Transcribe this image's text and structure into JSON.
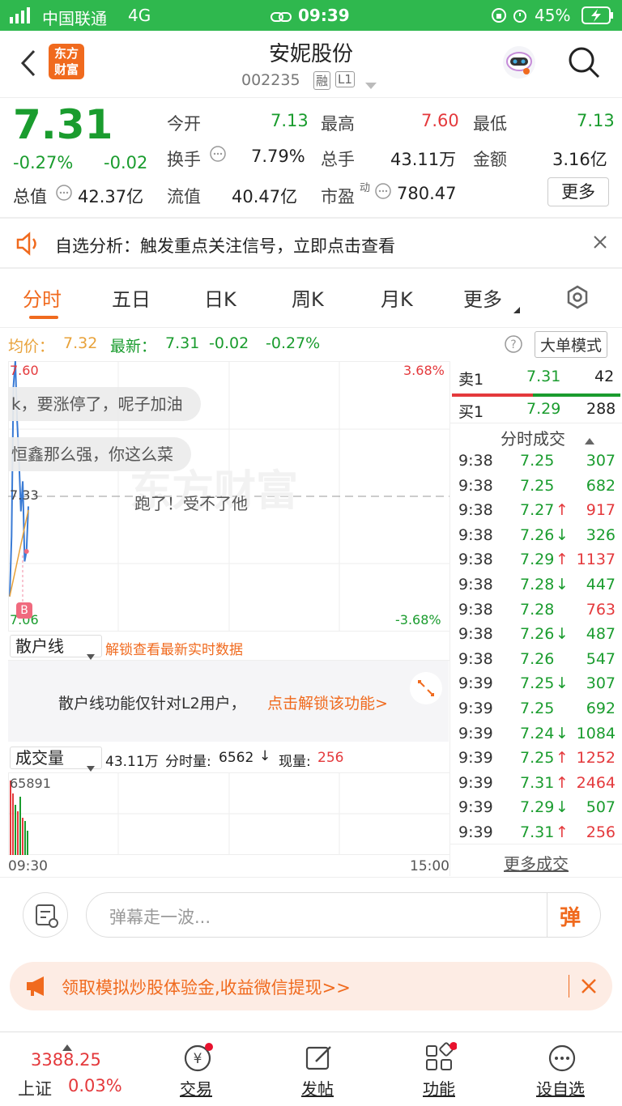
{
  "status": {
    "carrier": "中国联通",
    "network": "4G",
    "time": "09:39",
    "battery": "45%"
  },
  "header": {
    "logo_line1": "东方",
    "logo_line2": "财富",
    "stock_name": "安妮股份",
    "stock_code": "002235",
    "badge_rong": "融",
    "badge_l1": "L1"
  },
  "quote": {
    "price": "7.31",
    "change_pct": "-0.27%",
    "change": "-0.02",
    "total_value_label": "总值",
    "total_value": "42.37亿",
    "open_label": "今开",
    "open": "7.13",
    "high_label": "最高",
    "high": "7.60",
    "low_label": "最低",
    "low": "7.13",
    "turnover_label": "换手",
    "turnover": "7.79%",
    "volume_label": "总手",
    "volume": "43.11万",
    "amount_label": "金额",
    "amount": "3.16亿",
    "float_label": "流值",
    "float_value": "40.47亿",
    "pe_label": "市盈",
    "pe_sup": "动",
    "pe": "780.47",
    "more": "更多"
  },
  "alert": {
    "text": "自选分析：触发重点关注信号，立即点击查看"
  },
  "tabs": [
    "分时",
    "五日",
    "日K",
    "周K",
    "月K",
    "更多"
  ],
  "chart_info": {
    "avg_label": "均价：",
    "avg": "7.32",
    "latest_label": "最新：",
    "latest": "7.31",
    "latest_change": "-0.02",
    "latest_pct": "-0.27%",
    "big_order": "大单模式"
  },
  "chart": {
    "top_price": "7.60",
    "top_pct": "3.68%",
    "mid_price": "7.33",
    "bottom_price": "7.06",
    "bottom_pct": "-3.68%",
    "b_marker": "B",
    "danmaku1": "k，要涨停了，呢子加油",
    "danmaku2": "恒鑫那么强，你这么菜",
    "danmaku3": "跑了！受不了他",
    "watermark": "东方财富"
  },
  "chart_data": {
    "type": "line",
    "series": [
      {
        "values": [
          7.13,
          7.25,
          7.55,
          7.6,
          7.48,
          7.4,
          7.3,
          7.36,
          7.2,
          7.22,
          7.31
        ]
      }
    ],
    "ylim": [
      7.06,
      7.6
    ]
  },
  "retail": {
    "select": "散户线",
    "unlock": "解锁查看最新实时数据",
    "notice": "散户线功能仅针对L2用户，",
    "notice_link": "点击解锁该功能>"
  },
  "volume": {
    "select": "成交量",
    "total": "43.11万",
    "minute_label": "分时量:",
    "minute": "6562",
    "now_label": "现量:",
    "now": "256",
    "max": "65891",
    "time_start": "09:30",
    "time_end": "15:00"
  },
  "order_book": {
    "sell_label": "卖1",
    "sell_price": "7.31",
    "sell_qty": "42",
    "buy_label": "买1",
    "buy_price": "7.29",
    "buy_qty": "288"
  },
  "trades_title": "分时成交",
  "trades": [
    {
      "time": "9:38",
      "price": "7.25",
      "arrow": "",
      "qty": "307",
      "color": "green"
    },
    {
      "time": "9:38",
      "price": "7.25",
      "arrow": "",
      "qty": "682",
      "color": "green"
    },
    {
      "time": "9:38",
      "price": "7.27",
      "arrow": "↑",
      "qty": "917",
      "color": "red"
    },
    {
      "time": "9:38",
      "price": "7.26",
      "arrow": "↓",
      "qty": "326",
      "color": "green"
    },
    {
      "time": "9:38",
      "price": "7.29",
      "arrow": "↑",
      "qty": "1137",
      "color": "red"
    },
    {
      "time": "9:38",
      "price": "7.28",
      "arrow": "↓",
      "qty": "447",
      "color": "green"
    },
    {
      "time": "9:38",
      "price": "7.28",
      "arrow": "",
      "qty": "763",
      "color": "red"
    },
    {
      "time": "9:38",
      "price": "7.26",
      "arrow": "↓",
      "qty": "487",
      "color": "green"
    },
    {
      "time": "9:38",
      "price": "7.26",
      "arrow": "",
      "qty": "547",
      "color": "green"
    },
    {
      "time": "9:39",
      "price": "7.25",
      "arrow": "↓",
      "qty": "307",
      "color": "green"
    },
    {
      "time": "9:39",
      "price": "7.25",
      "arrow": "",
      "qty": "692",
      "color": "green"
    },
    {
      "time": "9:39",
      "price": "7.24",
      "arrow": "↓",
      "qty": "1084",
      "color": "green"
    },
    {
      "time": "9:39",
      "price": "7.25",
      "arrow": "↑",
      "qty": "1252",
      "color": "red"
    },
    {
      "time": "9:39",
      "price": "7.31",
      "arrow": "↑",
      "qty": "2464",
      "color": "red"
    },
    {
      "time": "9:39",
      "price": "7.29",
      "arrow": "↓",
      "qty": "507",
      "color": "green"
    },
    {
      "time": "9:39",
      "price": "7.31",
      "arrow": "↑",
      "qty": "256",
      "color": "red"
    }
  ],
  "more_trades": "更多成交",
  "comment": {
    "placeholder": "弹幕走一波...",
    "send": "弹"
  },
  "promo": {
    "text": "领取模拟炒股体验金,收益微信提现>>"
  },
  "tabbar": {
    "index_value": "3388.25",
    "index_name": "上证",
    "index_pct": "0.03%",
    "trade": "交易",
    "post": "发帖",
    "func": "功能",
    "add": "设自选"
  },
  "colors": {
    "up": "#e4393c",
    "down": "#1a9c2e",
    "brand": "#2fb84e",
    "accent": "#f07020"
  }
}
